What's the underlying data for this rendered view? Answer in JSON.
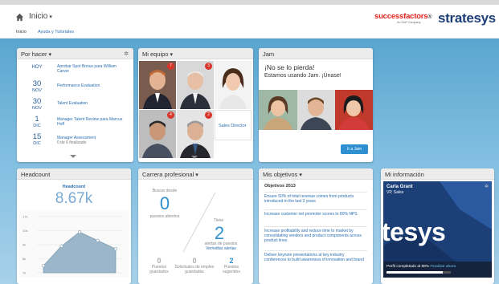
{
  "header": {
    "title": "Inicio",
    "brand_sf": "successfactors",
    "brand_sf_sub": "An SAP Company",
    "brand_st": "stratesys"
  },
  "subnav": {
    "items": [
      "Inicio",
      "Ayuda y Tutoriales"
    ]
  },
  "por_hacer": {
    "title": "Por hacer",
    "items": [
      {
        "day": "HOY",
        "month": "",
        "text": "Aprobar Spot Bonus para William Carver",
        "sub": ""
      },
      {
        "day": "30",
        "month": "NOV",
        "text": "Performance Evaluation",
        "sub": ""
      },
      {
        "day": "30",
        "month": "NOV",
        "text": "Talent Evaluation",
        "sub": ""
      },
      {
        "day": "1",
        "month": "DIC",
        "text": "Manager Talent Review para Marcus Hoff",
        "sub": ""
      },
      {
        "day": "15",
        "month": "DIC",
        "text": "Manager Assessment",
        "sub": "0 de 6 finalizado"
      }
    ]
  },
  "mi_equipo": {
    "title": "Mi equipo",
    "badges": [
      "7",
      "3",
      "",
      "4",
      "2"
    ],
    "sales_director": "Sales Director"
  },
  "jam": {
    "title": "Jam",
    "headline": "¡No se lo pierda!",
    "subline": "Estamos usando Jam. ¡Únase!",
    "button": "Ir a Jam"
  },
  "headcount": {
    "title": "Headcount",
    "label": "Headcount",
    "value": "8.67k",
    "y_ticks": [
      "17k",
      "10k",
      "9k",
      "8k",
      "7k"
    ]
  },
  "carrera": {
    "title": "Carrera profesional",
    "buscar_desde": "Buscar desde",
    "puestos_count": "0",
    "puestos_label": "puestos abiertos",
    "tiene": "Tiene",
    "alertas_count": "2",
    "alertas_label": "alertas de puestos",
    "ver_alertas": "Ver/editar alertas",
    "stats": [
      {
        "value": "0",
        "label": "Puestos guardados"
      },
      {
        "value": "0",
        "label": "Solicitudes de empleo guardadas"
      },
      {
        "value": "2",
        "label": "Puestos sugeridos"
      }
    ]
  },
  "objetivos": {
    "title": "Mis objetivos",
    "year": "Objetivos 2013",
    "items": [
      "Ensure 50% of total revenue comes from products introduced in the last 3 years",
      "Increase customer net promoter scores to 80% NPS",
      "Increase profitability and reduce time to market by consolidating vendors and product components across product lines",
      "Deliver keynote presentations at key industry conferences to build awareness of innovation and brand"
    ]
  },
  "mi_info": {
    "title": "Mi información",
    "name": "Carla Grant",
    "role": "VP, Sales",
    "logo_text": "tesys",
    "completion_label": "Perfil completado al 88%",
    "completion_link": "Finalizar ahora",
    "completion": 0.88
  },
  "colors": {
    "accent": "#2e8fd1",
    "badge": "#d9352b",
    "stage_top": "#5aa5cf"
  },
  "chart_data": {
    "type": "area",
    "title": "Headcount",
    "ylabel": "",
    "x": [
      1,
      2,
      3,
      4,
      5
    ],
    "values": [
      7500,
      8900,
      9900,
      9300,
      8700
    ],
    "ylim": [
      7000,
      11000
    ],
    "grid": true
  }
}
